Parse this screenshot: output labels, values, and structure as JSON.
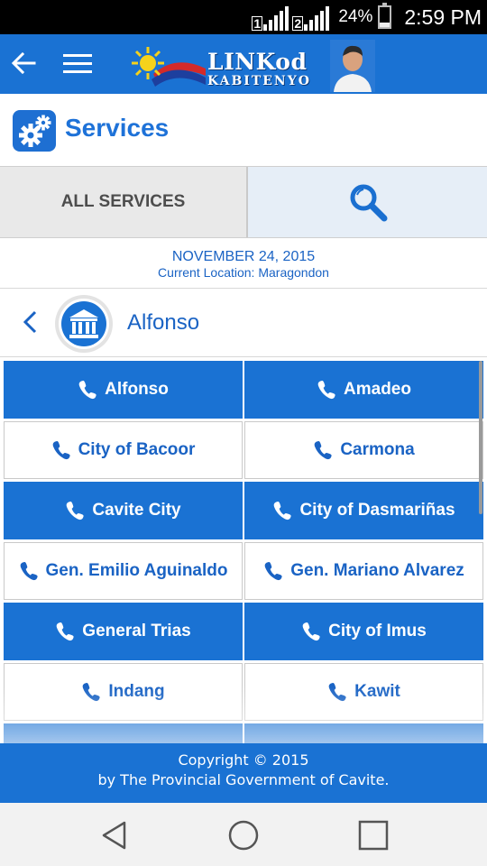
{
  "status_bar": {
    "sim1": "1",
    "sim2": "2",
    "battery": "24%",
    "battery_level": 0.24,
    "time": "2:59 PM"
  },
  "header": {
    "back_icon": "arrow-left-icon",
    "menu_icon": "hamburger-menu-icon",
    "logo_title": "LINKod",
    "logo_subtitle": "KABITENYO",
    "brand_color": "#1a72d3"
  },
  "page": {
    "title": "Services",
    "icon": "gears-icon"
  },
  "tabs": {
    "all_services": "ALL SERVICES",
    "search_icon": "search-icon"
  },
  "info": {
    "date": "NOVEMBER 24, 2015",
    "location": "Current Location: Maragondon"
  },
  "municipality": {
    "name": "Alfonso",
    "back_icon": "chevron-left-icon",
    "badge_icon": "city-hall-icon"
  },
  "directory": {
    "icon": "phone-icon",
    "items": [
      {
        "label": "Alfonso",
        "style": "blue"
      },
      {
        "label": "Amadeo",
        "style": "blue"
      },
      {
        "label": "City of Bacoor",
        "style": "white"
      },
      {
        "label": "Carmona",
        "style": "white"
      },
      {
        "label": "Cavite City",
        "style": "blue"
      },
      {
        "label": "City of Dasmariñas",
        "style": "blue"
      },
      {
        "label": "Gen. Emilio Aguinaldo",
        "style": "white"
      },
      {
        "label": "Gen. Mariano Alvarez",
        "style": "white"
      },
      {
        "label": "General Trias",
        "style": "blue"
      },
      {
        "label": "City of Imus",
        "style": "blue"
      },
      {
        "label": "Indang",
        "style": "white"
      },
      {
        "label": "Kawit",
        "style": "white"
      }
    ]
  },
  "footer": {
    "line1": "Copyright © 2015",
    "line2": "by The Provincial Government of Cavite."
  },
  "nav": {
    "back": "triangle-back-icon",
    "home": "circle-home-icon",
    "recents": "square-recents-icon"
  }
}
